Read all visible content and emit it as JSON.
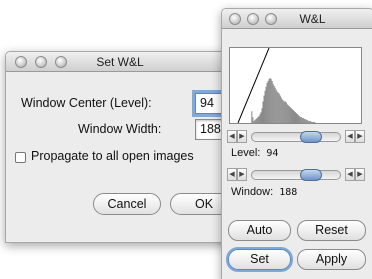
{
  "set_dialog": {
    "title": "Set W&L",
    "center_label": "Window Center (Level):",
    "center_value": "94",
    "width_label": "Window Width:",
    "width_value": "188",
    "propagate_label": "Propagate to all open images",
    "cancel_label": "Cancel",
    "ok_label": "OK"
  },
  "wl_panel": {
    "title": "W&L",
    "level_label": "Level:",
    "level_value": "94",
    "window_label": "Window:",
    "window_value": "188",
    "auto_label": "Auto",
    "reset_label": "Reset",
    "set_label": "Set",
    "apply_label": "Apply",
    "level_slider_fraction": 0.72,
    "window_slider_fraction": 0.72,
    "histogram": [
      0,
      0,
      0,
      0,
      0,
      0,
      0,
      0,
      0,
      0,
      0,
      0,
      0,
      0,
      0,
      0,
      0,
      0,
      0,
      0,
      0,
      12,
      6,
      2,
      3,
      4,
      5,
      6,
      7,
      9,
      11,
      15,
      22,
      28,
      33,
      37,
      41,
      43,
      45,
      46,
      45,
      43,
      40,
      38,
      36,
      34,
      32,
      31,
      30,
      28,
      26,
      24,
      23,
      22,
      22,
      21,
      19,
      18,
      17,
      16,
      15,
      14,
      13,
      12,
      11,
      10,
      9,
      8,
      7,
      6,
      6,
      5,
      5,
      4,
      4,
      3,
      3,
      2,
      2,
      2,
      1,
      1,
      1,
      1,
      0,
      0,
      0,
      0,
      0,
      0,
      0,
      0,
      0,
      0,
      0,
      0,
      0,
      0,
      0,
      0,
      0,
      0,
      0,
      0,
      0,
      0,
      0,
      0,
      0,
      0,
      0,
      0,
      0,
      0,
      0,
      0,
      0,
      0,
      0,
      0,
      0,
      0,
      0,
      0,
      0,
      0,
      0,
      0,
      0
    ]
  }
}
